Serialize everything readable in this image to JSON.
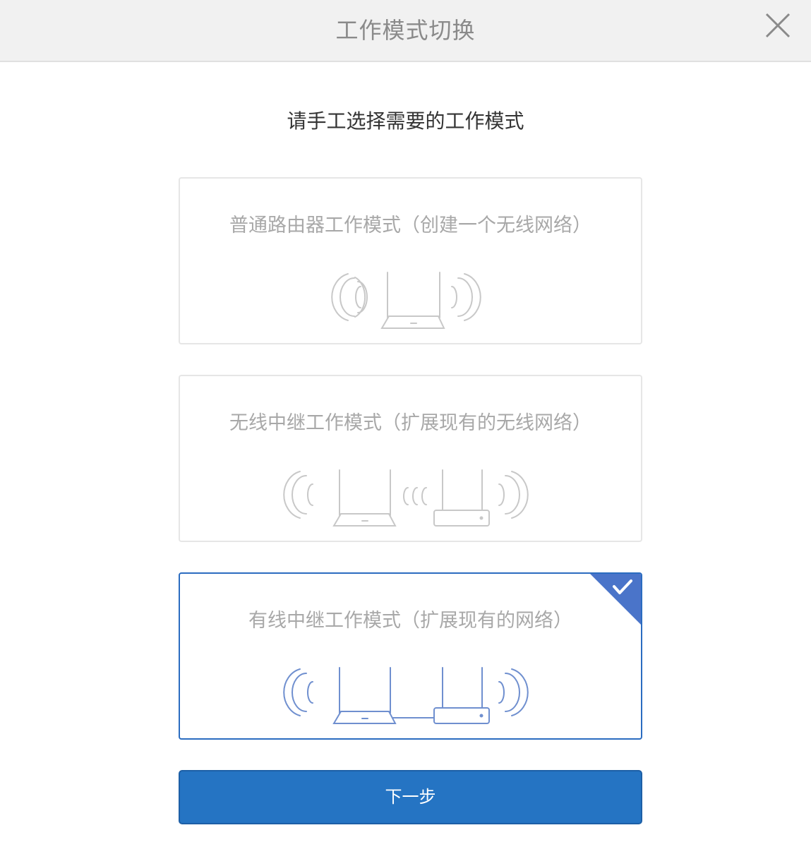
{
  "header": {
    "title": "工作模式切换"
  },
  "subtitle": "请手工选择需要的工作模式",
  "modes": [
    {
      "label": "普通路由器工作模式（创建一个无线网络）",
      "selected": false
    },
    {
      "label": "无线中继工作模式（扩展现有的无线网络）",
      "selected": false
    },
    {
      "label": "有线中继工作模式（扩展现有的网络）",
      "selected": true
    }
  ],
  "next_button": {
    "label": "下一步"
  },
  "colors": {
    "accent": "#2574c3",
    "selected_border": "#2b6cc0",
    "icon_gray": "#c8c8c8",
    "icon_blue": "#6f8fcf"
  },
  "icons": {
    "close": "close-icon",
    "check": "check-icon",
    "router": "router-icon",
    "extender": "extender-icon",
    "wifi": "wifi-waves-icon"
  }
}
